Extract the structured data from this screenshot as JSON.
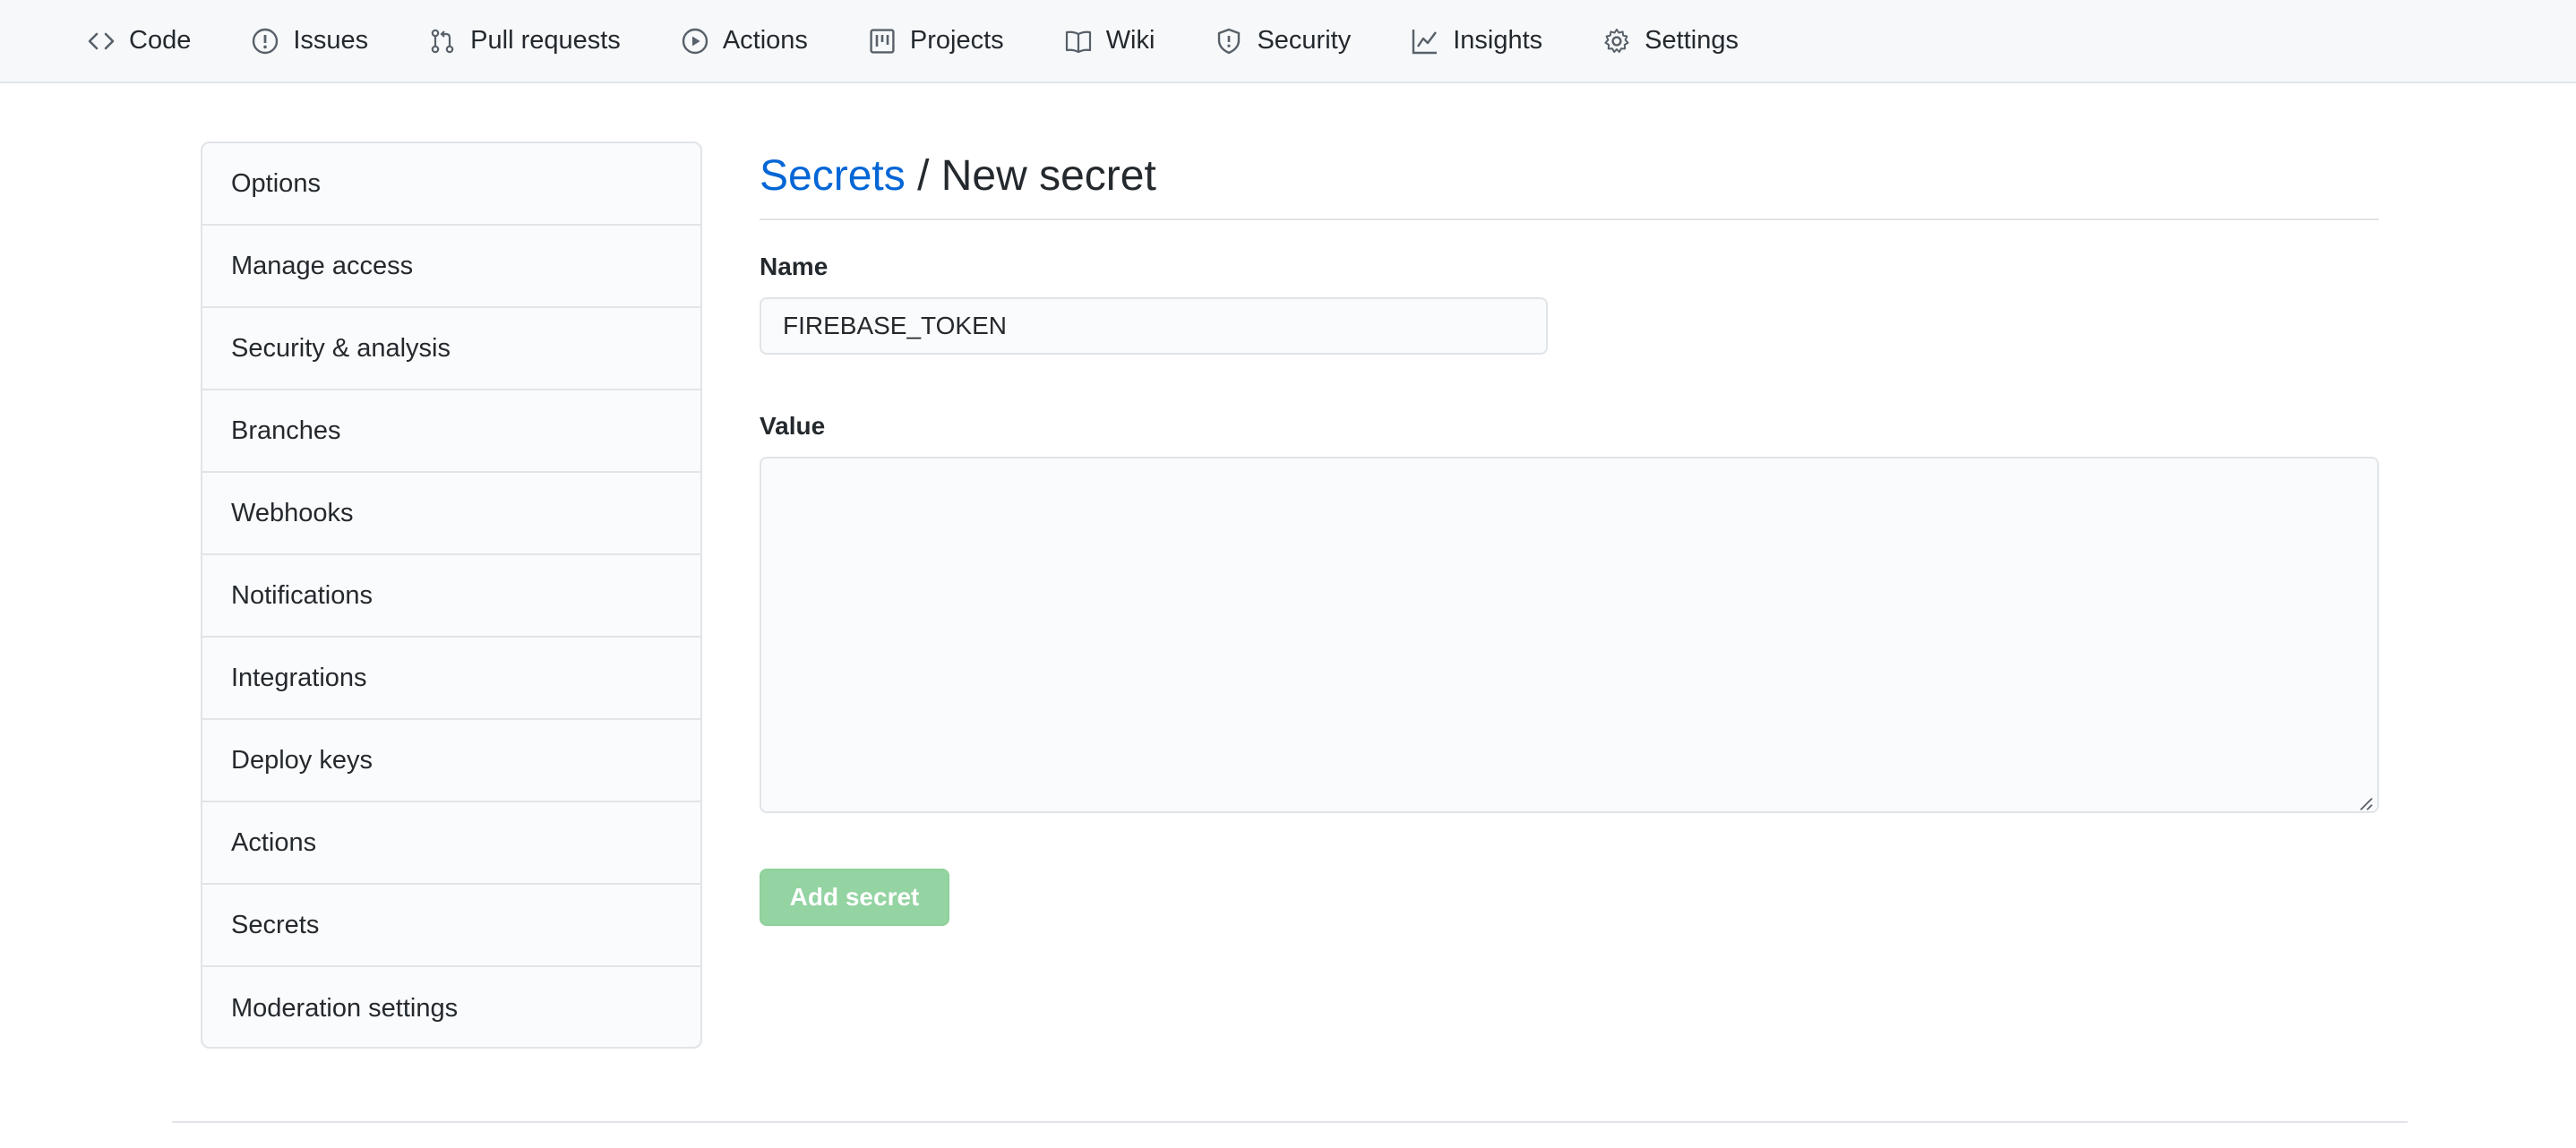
{
  "nav": {
    "tabs": [
      {
        "label": "Code",
        "icon": "code-icon"
      },
      {
        "label": "Issues",
        "icon": "issue-icon"
      },
      {
        "label": "Pull requests",
        "icon": "pull-request-icon"
      },
      {
        "label": "Actions",
        "icon": "play-icon"
      },
      {
        "label": "Projects",
        "icon": "project-icon"
      },
      {
        "label": "Wiki",
        "icon": "book-icon"
      },
      {
        "label": "Security",
        "icon": "shield-icon"
      },
      {
        "label": "Insights",
        "icon": "graph-icon"
      },
      {
        "label": "Settings",
        "icon": "gear-icon"
      }
    ]
  },
  "sidebar": {
    "items": [
      {
        "label": "Options"
      },
      {
        "label": "Manage access"
      },
      {
        "label": "Security & analysis"
      },
      {
        "label": "Branches"
      },
      {
        "label": "Webhooks"
      },
      {
        "label": "Notifications"
      },
      {
        "label": "Integrations"
      },
      {
        "label": "Deploy keys"
      },
      {
        "label": "Actions"
      },
      {
        "label": "Secrets"
      },
      {
        "label": "Moderation settings"
      }
    ]
  },
  "main": {
    "breadcrumb_link": "Secrets",
    "breadcrumb_sep": " / ",
    "title": "New secret",
    "name_label": "Name",
    "name_value": "FIREBASE_TOKEN",
    "value_label": "Value",
    "value_text": "",
    "submit_label": "Add secret"
  },
  "colors": {
    "link": "#0366d6",
    "button_disabled_green": "#94d3a2",
    "border": "#e1e4e8",
    "nav_bg": "#f6f8fa"
  }
}
